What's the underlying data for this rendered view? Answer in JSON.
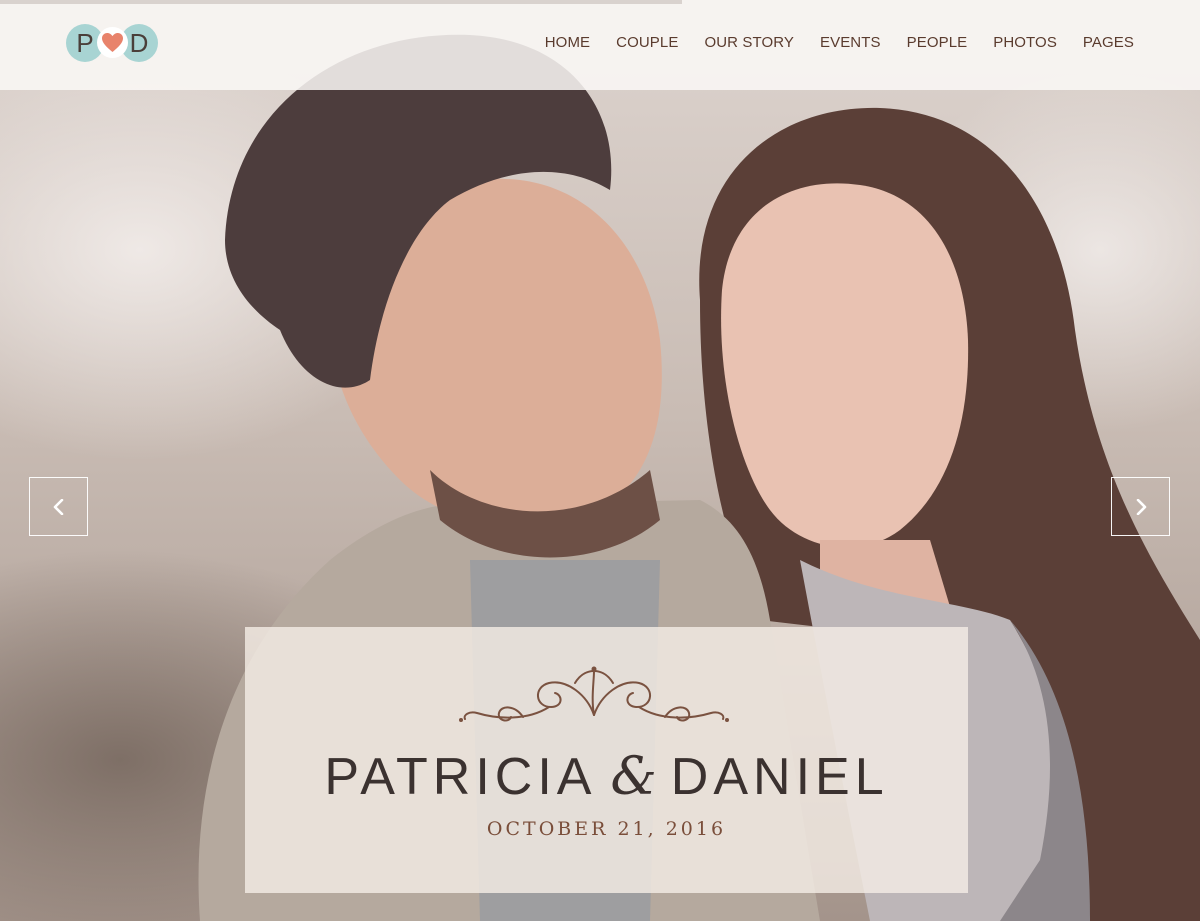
{
  "header": {
    "logo": {
      "left_letter": "P",
      "right_letter": "D",
      "icon": "heart-icon",
      "heart_color": "#e8836b",
      "circle_color": "#a8d4d3"
    },
    "nav": [
      {
        "label": "HOME"
      },
      {
        "label": "COUPLE"
      },
      {
        "label": "OUR STORY"
      },
      {
        "label": "EVENTS"
      },
      {
        "label": "PEOPLE"
      },
      {
        "label": "PHOTOS"
      },
      {
        "label": "PAGES"
      }
    ]
  },
  "slider": {
    "prev_icon": "chevron-left-icon",
    "next_icon": "chevron-right-icon"
  },
  "hero": {
    "first_name": "PATRICIA",
    "ampersand": "&",
    "second_name": "DANIEL",
    "date": "OCTOBER 21, 2016",
    "ornament_icon": "flourish-ornament-icon"
  },
  "colors": {
    "nav_text": "#5a3b2e",
    "title_text": "#3b3230",
    "date_text": "#7a4e3a"
  }
}
